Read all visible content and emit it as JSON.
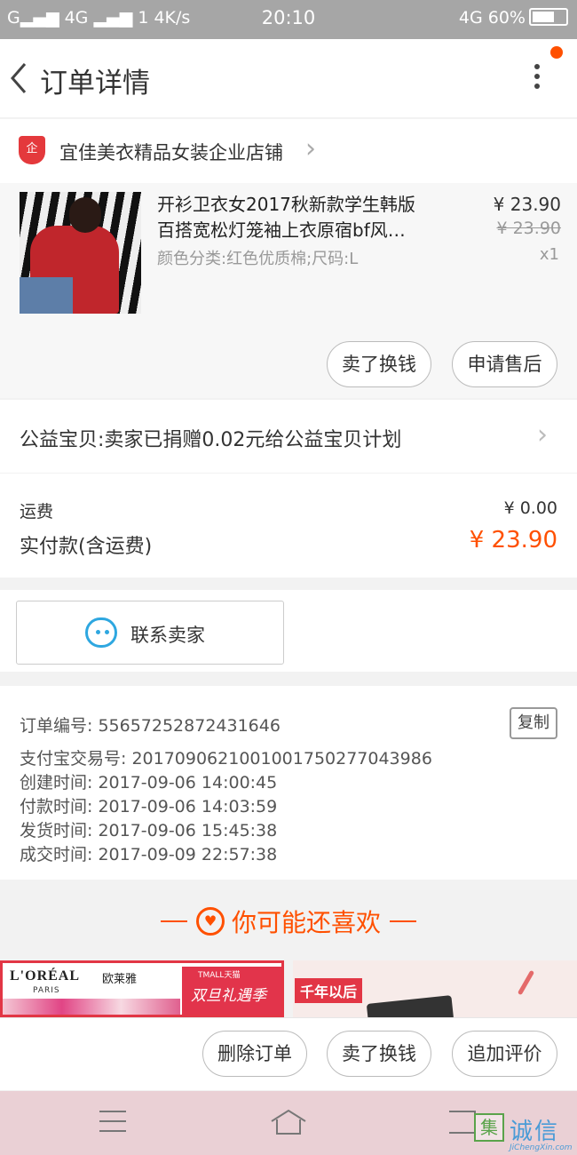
{
  "status_bar": {
    "left": "G▂▄▆ 4G ▂▄▆ 1 4K/s",
    "time": "20:10",
    "right": "4G 60%"
  },
  "nav": {
    "back_icon": "chevron-left-icon",
    "title": "订单详情",
    "more_icon": "more-vertical-icon"
  },
  "shop": {
    "badge": "企",
    "name": "宜佳美衣精品女装企业店铺",
    "arrow": "›"
  },
  "product": {
    "title": "开衫卫衣女2017秋新款学生韩版百搭宽松灯笼袖上衣原宿bf风…",
    "spec": "颜色分类:红色优质棉;尺码:L",
    "price": "¥ 23.90",
    "original_price": "¥ 23.90",
    "quantity": "x1"
  },
  "product_actions": {
    "sell_exchange": "卖了换钱",
    "after_sale": "申请售后"
  },
  "charity": {
    "text": "公益宝贝:卖家已捐赠0.02元给公益宝贝计划",
    "arrow": "›"
  },
  "cost": {
    "shipping_label": "运费",
    "shipping_value": "¥ 0.00",
    "paid_label": "实付款(含运费)",
    "paid_value": "¥ 23.90"
  },
  "contact": {
    "label": "联系卖家",
    "icon": "chat-bubble-icon"
  },
  "order_info": {
    "order_no": "订单编号: 55657252872431646",
    "alipay_no": "支付宝交易号: 2017090621001001750277043986",
    "created": "创建时间: 2017-09-06  14:00:45",
    "paid": "付款时间: 2017-09-06  14:03:59",
    "shipped": "发货时间: 2017-09-06  15:45:38",
    "completed": "成交时间: 2017-09-09  22:57:38",
    "copy_label": "复制"
  },
  "recommend": {
    "title": "你可能还喜欢",
    "heart": "♥"
  },
  "ads": {
    "left_brand": "L'ORÉAL",
    "left_brand_cn": "欧莱雅",
    "left_brand_sub": "PARIS",
    "left_tmall": "TMALL天猫",
    "left_campaign": "双旦礼遇季",
    "right_tag": "千年以后"
  },
  "bottom_actions": {
    "delete": "删除订单",
    "sell_exchange": "卖了换钱",
    "add_review": "追加评价"
  },
  "watermark": {
    "mark": "集",
    "name": "诚信",
    "url": "JiChengXin.com"
  },
  "colors": {
    "accent": "#ff5000",
    "shop_badge": "#e4393c",
    "contact_icon": "#2ea7e0"
  }
}
